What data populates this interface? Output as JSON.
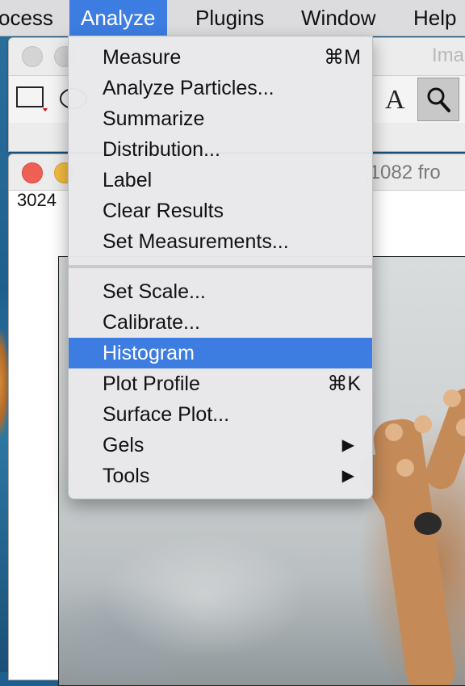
{
  "menubar": {
    "items": [
      {
        "label": "ocess",
        "active": false
      },
      {
        "label": "Analyze",
        "active": true
      },
      {
        "label": "Plugins",
        "active": false
      },
      {
        "label": "Window",
        "active": false
      },
      {
        "label": "Help",
        "active": false
      }
    ]
  },
  "toolbar_window": {
    "title": "Ima"
  },
  "image_window": {
    "title": ",1082 fro",
    "info_line": "3024"
  },
  "analyze_menu": {
    "group1": [
      {
        "label": "Measure",
        "shortcut": "⌘M"
      },
      {
        "label": "Analyze Particles..."
      },
      {
        "label": "Summarize"
      },
      {
        "label": "Distribution..."
      },
      {
        "label": "Label"
      },
      {
        "label": "Clear Results"
      },
      {
        "label": "Set Measurements..."
      }
    ],
    "group2": [
      {
        "label": "Set Scale..."
      },
      {
        "label": "Calibrate..."
      },
      {
        "label": "Histogram",
        "highlighted": true
      },
      {
        "label": "Plot Profile",
        "shortcut": "⌘K"
      },
      {
        "label": "Surface Plot..."
      },
      {
        "label": "Gels",
        "submenu": true,
        "submenu_glyph": "▶"
      },
      {
        "label": "Tools",
        "submenu": true,
        "submenu_glyph": "▶"
      }
    ]
  },
  "colors": {
    "highlight": "#3d7de2",
    "close_button": "#ee5f55",
    "minimize_button": "#f5bd40"
  },
  "icons": {
    "rectangle_tool": "rectangle-selection-icon",
    "oval_tool": "oval-selection-icon",
    "text_tool": "text-tool-icon",
    "text_tool_glyph": "A",
    "zoom_tool": "magnifier-icon"
  }
}
